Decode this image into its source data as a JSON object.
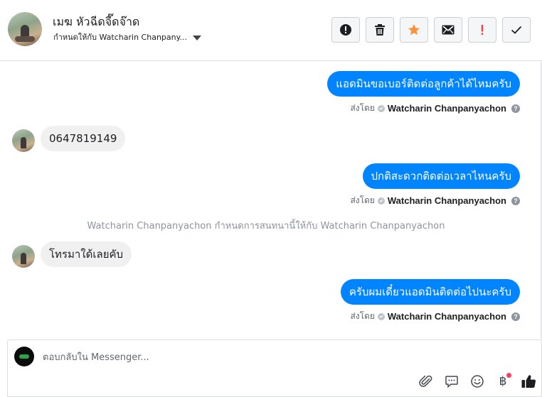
{
  "header": {
    "contact_name": "เมฆ หัวฉีดจี๊ดจ๊าด",
    "assigned_to": "กำหนดให้กับ Watcharin Chanpany...",
    "toolbar": [
      {
        "name": "spam-button",
        "icon": "alert-circle-icon"
      },
      {
        "name": "delete-button",
        "icon": "trash-icon"
      },
      {
        "name": "star-button",
        "icon": "star-icon",
        "color": "#f7923b"
      },
      {
        "name": "mark-unread-button",
        "icon": "envelope-icon"
      },
      {
        "name": "follow-up-button",
        "icon": "exclamation-icon",
        "color": "#fa3e3e"
      },
      {
        "name": "mark-done-button",
        "icon": "check-icon"
      }
    ]
  },
  "messages": [
    {
      "dir": "out",
      "text": "แอดมินขอเบอร์ติดต่อลูกค้าได้ไหมครับ"
    },
    {
      "dir": "in",
      "text": "0647819149"
    },
    {
      "dir": "out",
      "text": "ปกติสะดวกติดต่อเวลาไหนครับ"
    },
    {
      "dir": "in",
      "text": "โทรมาใด้เลยคับ"
    },
    {
      "dir": "out",
      "text": "ครับผมเดี๋ยวแอดมินติดต่อไปนะครับ"
    }
  ],
  "sent_by": {
    "label": "ส่งโดย",
    "name": "Watcharin Chanpanyachon",
    "help": "?"
  },
  "system_note": "Watcharin Chanpanyachon กำหนดการสนทนานี้ให้กับ Watcharin Chanpanyachon",
  "composer": {
    "placeholder": "ตอบกลับใน Messenger...",
    "icons": [
      "paperclip-icon",
      "saved-reply-icon",
      "emoji-icon",
      "baht-payment-icon",
      "thumbs-up-icon"
    ],
    "baht_symbol": "฿"
  },
  "colors": {
    "accent": "#0084ff",
    "incoming_bubble": "#f1f0f0",
    "star": "#f7923b",
    "follow_up": "#fa3e3e"
  }
}
